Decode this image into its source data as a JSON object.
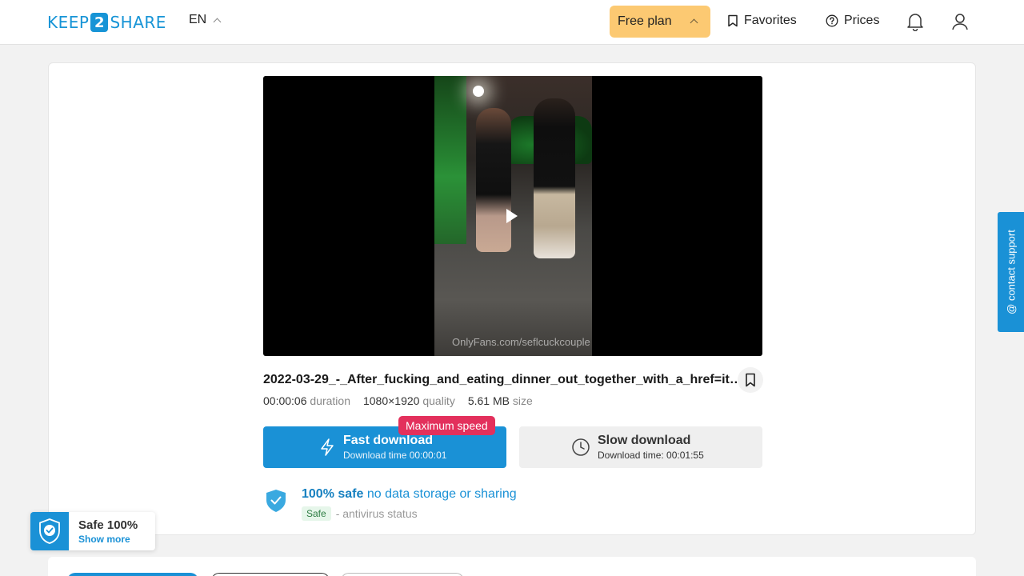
{
  "header": {
    "logo_left": "KEEP",
    "logo_num": "2",
    "logo_right": "SHARE",
    "language": "EN",
    "plan_label": "Free plan",
    "favorites_label": "Favorites",
    "prices_label": "Prices"
  },
  "file": {
    "name": "2022-03-29_-_After_fucking_and_eating_dinner_out_together_with_a_href=ita...",
    "watermark": "OnlyFans.com/seflcuckcouple",
    "duration_value": "00:00:06",
    "duration_label": "duration",
    "quality_value": "1080×1920",
    "quality_label": "quality",
    "size_value": "5.61 MB",
    "size_label": "size"
  },
  "download": {
    "speed_badge": "Maximum speed",
    "fast_title": "Fast download",
    "fast_time": "Download time 00:00:01",
    "slow_title": "Slow download",
    "slow_time": "Download time: 00:01:55"
  },
  "safety": {
    "bold": "100% safe",
    "rest": "no data storage or sharing",
    "tag": "Safe",
    "status": "- antivirus status"
  },
  "support_label": "@ contact support",
  "safe_widget": {
    "title": "Safe 100%",
    "link": "Show more"
  },
  "colors": {
    "brand_blue": "#1a91d6",
    "plan_yellow": "#fcc972",
    "badge_pink": "#e3305c"
  }
}
